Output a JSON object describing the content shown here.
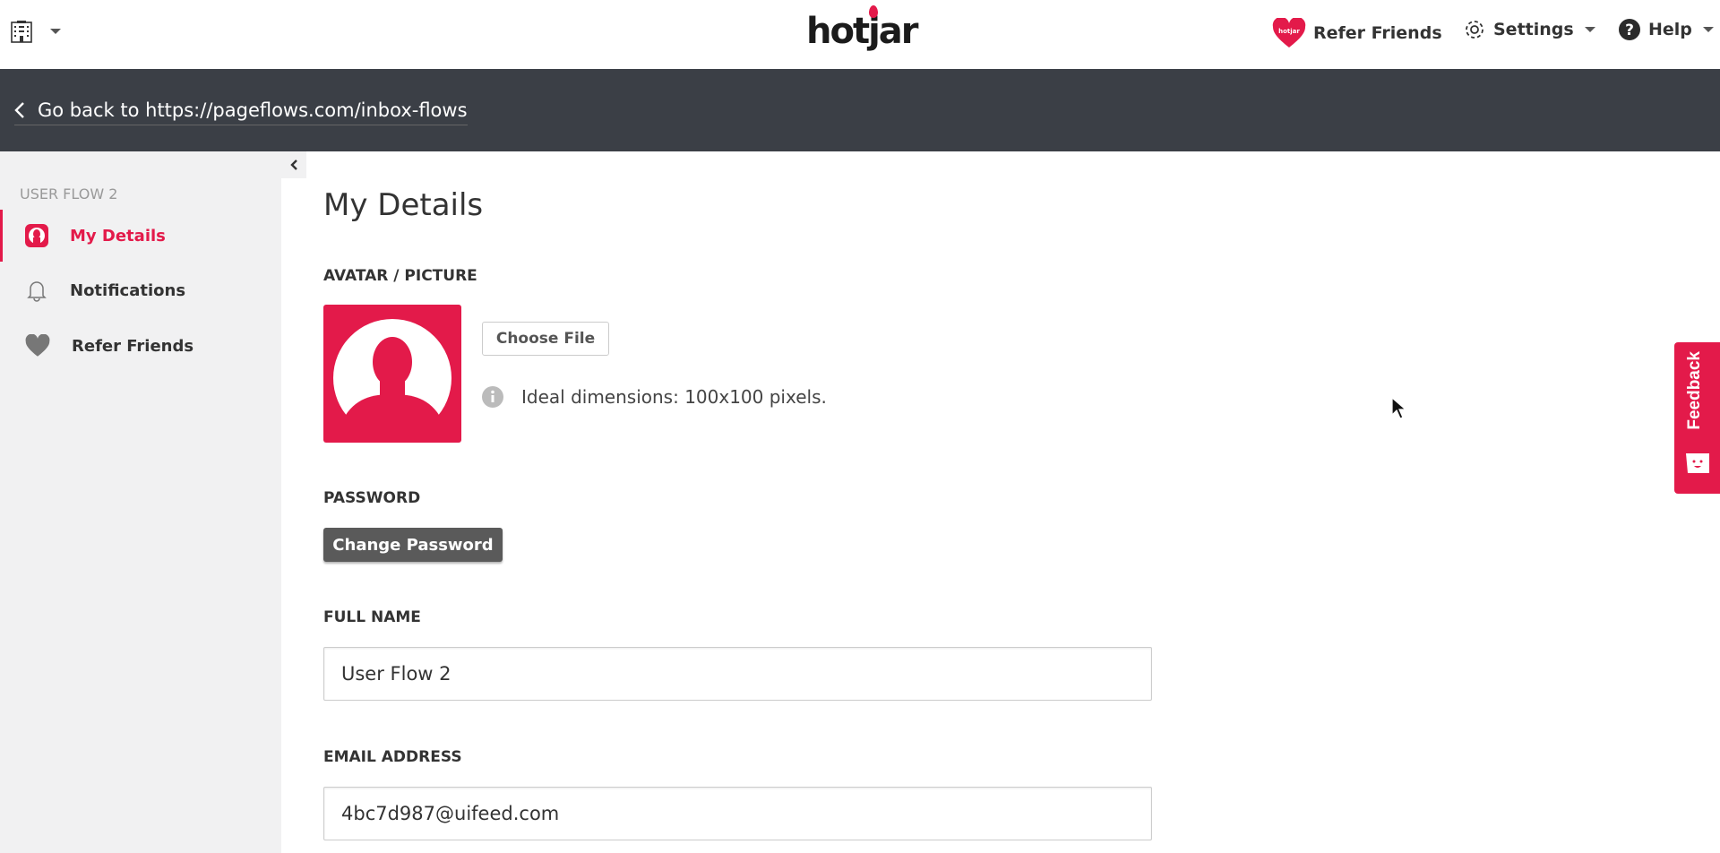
{
  "header": {
    "logo": "hotjar",
    "refer_friends": "Refer Friends",
    "settings": "Settings",
    "help": "Help",
    "brand_color": "#e31a4a"
  },
  "backbar": {
    "label": "Go back to https://pageflows.com/inbox-flows"
  },
  "sidebar": {
    "heading": "USER FLOW 2",
    "items": [
      {
        "label": "My Details",
        "icon": "user-icon",
        "active": true
      },
      {
        "label": "Notifications",
        "icon": "bell-icon",
        "active": false
      },
      {
        "label": "Refer Friends",
        "icon": "heart-icon",
        "active": false
      }
    ]
  },
  "main": {
    "title": "My Details",
    "avatar_label": "AVATAR / PICTURE",
    "choose_file": "Choose File",
    "dimensions_hint": "Ideal dimensions: 100x100 pixels.",
    "password_label": "PASSWORD",
    "change_password": "Change Password",
    "full_name_label": "FULL NAME",
    "full_name_value": "User Flow 2",
    "email_label": "EMAIL ADDRESS",
    "email_value": "4bc7d987@uifeed.com"
  },
  "feedback": {
    "label": "Feedback"
  }
}
